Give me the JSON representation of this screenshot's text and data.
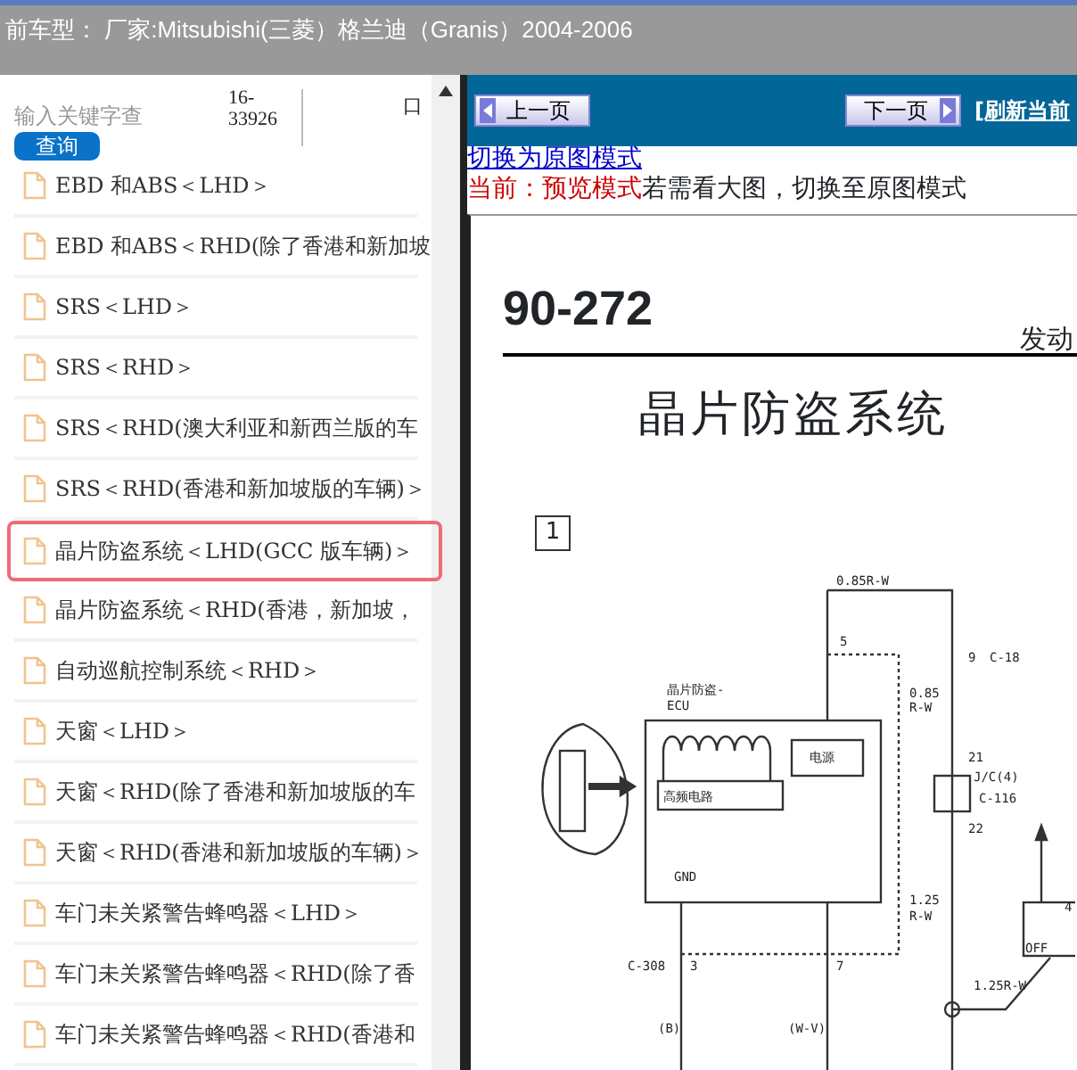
{
  "title_bar": {
    "text": "前车型：  厂家:Mitsubishi(三菱）格兰迪（Granis）2004-2006"
  },
  "search": {
    "placeholder": "输入关键字查",
    "code": "16-33926",
    "mark": "口",
    "button": "查询"
  },
  "topics": [
    {
      "label": "EBD 和ABS＜LHD＞",
      "selected": false
    },
    {
      "label": "EBD 和ABS＜RHD(除了香港和新加坡",
      "selected": false
    },
    {
      "label": "SRS＜LHD＞",
      "selected": false
    },
    {
      "label": "SRS＜RHD＞",
      "selected": false
    },
    {
      "label": "SRS＜RHD(澳大利亚和新西兰版的车",
      "selected": false
    },
    {
      "label": "SRS＜RHD(香港和新加坡版的车辆)＞",
      "selected": false
    },
    {
      "label": "晶片防盗系统＜LHD(GCC 版车辆)＞",
      "selected": true
    },
    {
      "label": "晶片防盗系统＜RHD(香港，新加坡，",
      "selected": false
    },
    {
      "label": "自动巡航控制系统＜RHD＞",
      "selected": false
    },
    {
      "label": "天窗＜LHD＞",
      "selected": false
    },
    {
      "label": "天窗＜RHD(除了香港和新加坡版的车",
      "selected": false
    },
    {
      "label": "天窗＜RHD(香港和新加坡版的车辆)＞",
      "selected": false
    },
    {
      "label": "车门未关紧警告蜂鸣器＜LHD＞",
      "selected": false
    },
    {
      "label": "车门未关紧警告蜂鸣器＜RHD(除了香",
      "selected": false
    },
    {
      "label": "车门未关紧警告蜂鸣器＜RHD(香港和",
      "selected": false
    }
  ],
  "toolbar": {
    "prev": "上一页",
    "next": "下一页",
    "refresh": "[刷新当前"
  },
  "mode": {
    "switch_link": "切换为原图模式",
    "current": "当前：预览模式",
    "hint": "若需看大图，切换至原图模式"
  },
  "document": {
    "page_number": "90-272",
    "section": "发动",
    "title": "晶片防盗系统",
    "figure_number": "1",
    "labels": [
      "0.85R-W",
      "5",
      "9",
      "C-18",
      "0.85",
      "R-W",
      "晶片防盗-",
      "ECU",
      "电源",
      "高频电路",
      "GND",
      "21",
      "J/C(4)",
      "C-116",
      "22",
      "1.25",
      "R-W",
      "C-308",
      "3",
      "7",
      "(B)",
      "(W-V)",
      "1.25R-W",
      "OFF",
      "4"
    ]
  }
}
